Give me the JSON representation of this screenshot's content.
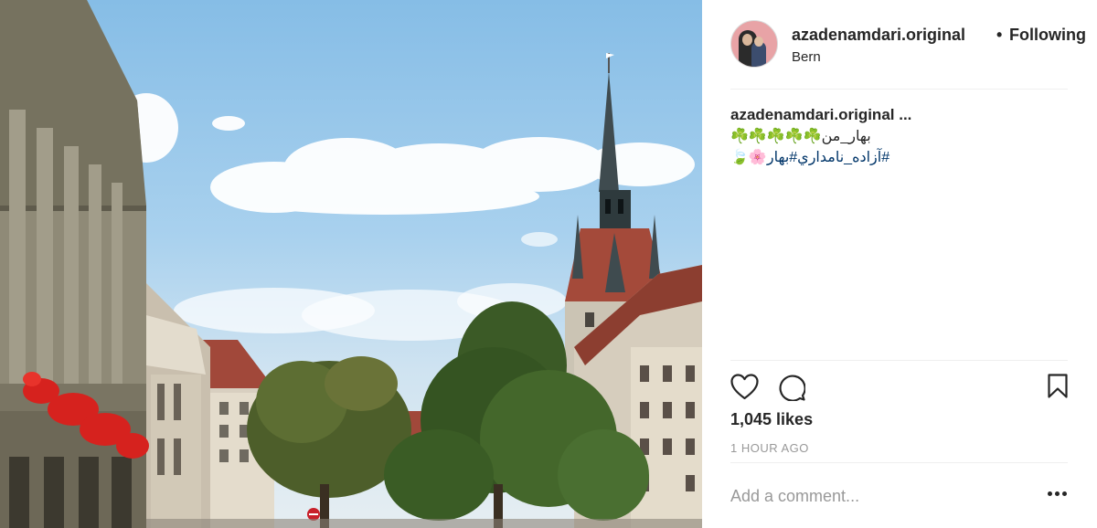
{
  "post": {
    "image_alt": "Street view in Bern with clock tower and trees"
  },
  "header": {
    "username": "azadenamdari.original",
    "separator": "•",
    "follow_label": "Following",
    "location": "Bern"
  },
  "caption": {
    "username": "azadenamdari.original ...",
    "line1": "بهار_من☘️☘️☘️☘️☘️",
    "line2": "#آزاده_نامداري#بهار🌸🍃"
  },
  "actions": {
    "like_icon": "heart-icon",
    "comment_icon": "comment-icon",
    "save_icon": "bookmark-icon"
  },
  "likes": "1,045 likes",
  "timestamp": "1 HOUR AGO",
  "comment": {
    "placeholder": "Add a comment...",
    "more_icon": "more-icon"
  }
}
